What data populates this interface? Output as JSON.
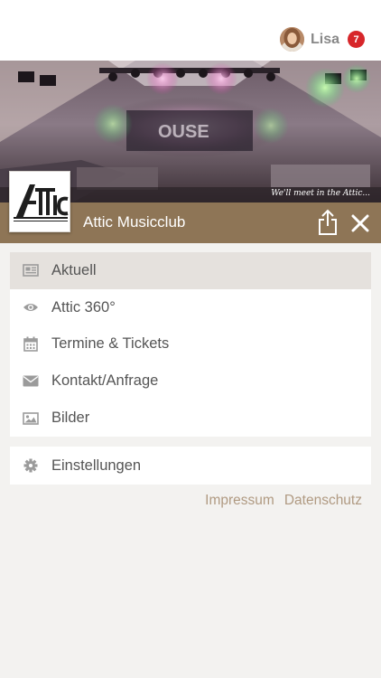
{
  "header": {
    "user_name": "Lisa",
    "notification_count": "7",
    "badge_color": "#d7262a",
    "avatar": "user-avatar-photo"
  },
  "banner": {
    "image": "club-stage-photo",
    "tagline": "We'll meet in the Attic..."
  },
  "club": {
    "logo_text": "Attic",
    "title": "Attic Musicclub",
    "share_icon": "share-icon",
    "close_icon": "close-icon",
    "accent_color": "#8e7556"
  },
  "menu": {
    "items": [
      {
        "label": "Aktuell",
        "icon": "newspaper-icon",
        "active": true
      },
      {
        "label": "Attic 360°",
        "icon": "eye-icon",
        "active": false
      },
      {
        "label": "Termine & Tickets",
        "icon": "calendar-icon",
        "active": false
      },
      {
        "label": "Kontakt/Anfrage",
        "icon": "envelope-icon",
        "active": false
      },
      {
        "label": "Bilder",
        "icon": "image-icon",
        "active": false
      }
    ],
    "settings": {
      "label": "Einstellungen",
      "icon": "gear-icon"
    }
  },
  "footer": {
    "impressum": "Impressum",
    "datenschutz": "Datenschutz"
  }
}
